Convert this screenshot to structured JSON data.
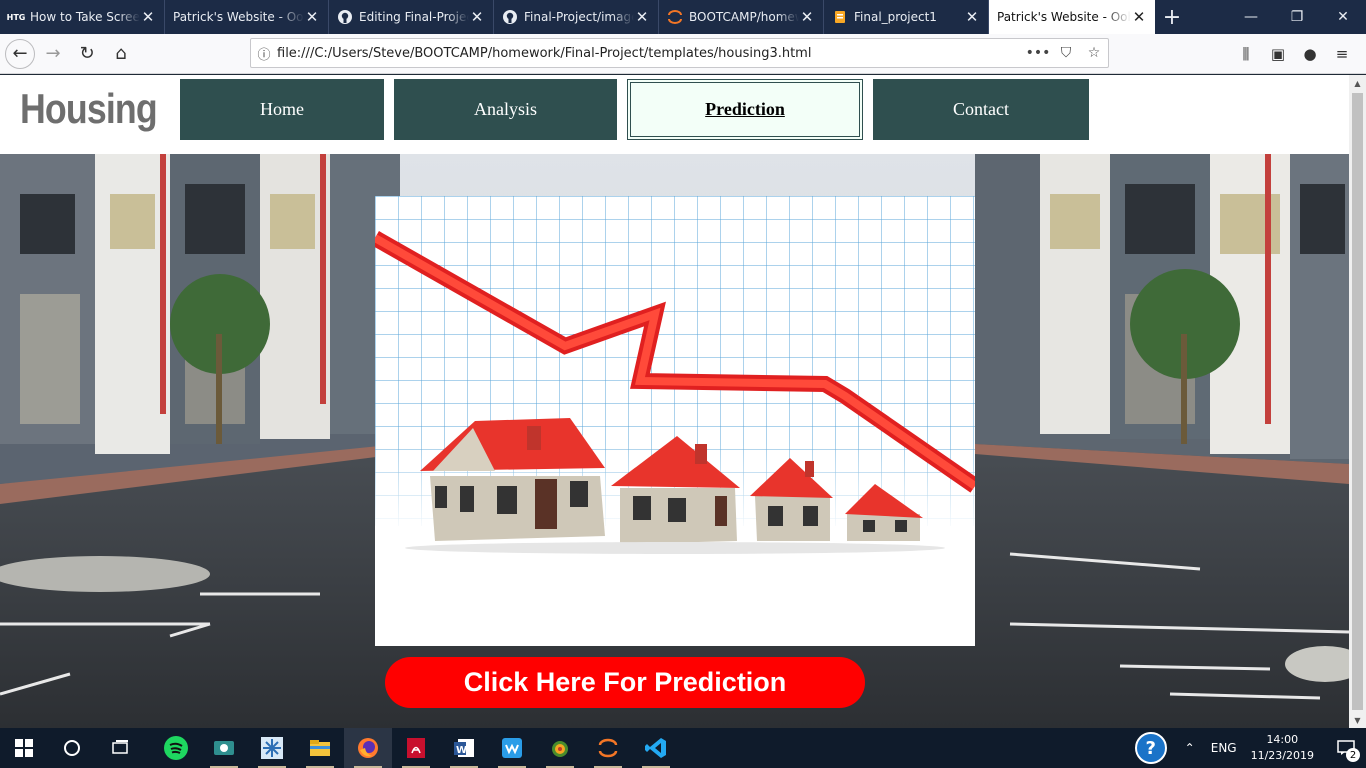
{
  "browser": {
    "tabs": [
      {
        "title": "How to Take Screen",
        "favicon_text": "HTG",
        "active": false
      },
      {
        "title": "Patrick's Website - Ooh,",
        "favicon_text": "",
        "active": false
      },
      {
        "title": "Editing Final-Project",
        "favicon_text": "",
        "active": false
      },
      {
        "title": "Final-Project/image",
        "favicon_text": "",
        "active": false
      },
      {
        "title": "BOOTCAMP/homew",
        "favicon_text": "",
        "active": false
      },
      {
        "title": "Final_project1",
        "favicon_text": "",
        "active": false
      },
      {
        "title": "Patrick's Website - Ooh,",
        "favicon_text": "",
        "active": true
      }
    ],
    "url": "file:///C:/Users/Steve/BOOTCAMP/homework/Final-Project/templates/housing3.html",
    "url_actions_glyph": "•••"
  },
  "site": {
    "logo": "Housing",
    "nav": {
      "home": "Home",
      "analysis": "Analysis",
      "prediction": "Prediction",
      "contact": "Contact"
    },
    "cta_label": "Click Here For Prediction"
  },
  "taskbar": {
    "language": "ENG",
    "time": "14:00",
    "date": "11/23/2019",
    "notification_count": "2"
  },
  "colors": {
    "nav_bg": "#2f4f4f",
    "nav_active_bg": "#f3fff8",
    "cta": "#ff0000",
    "logo": "#6e6e6e"
  }
}
